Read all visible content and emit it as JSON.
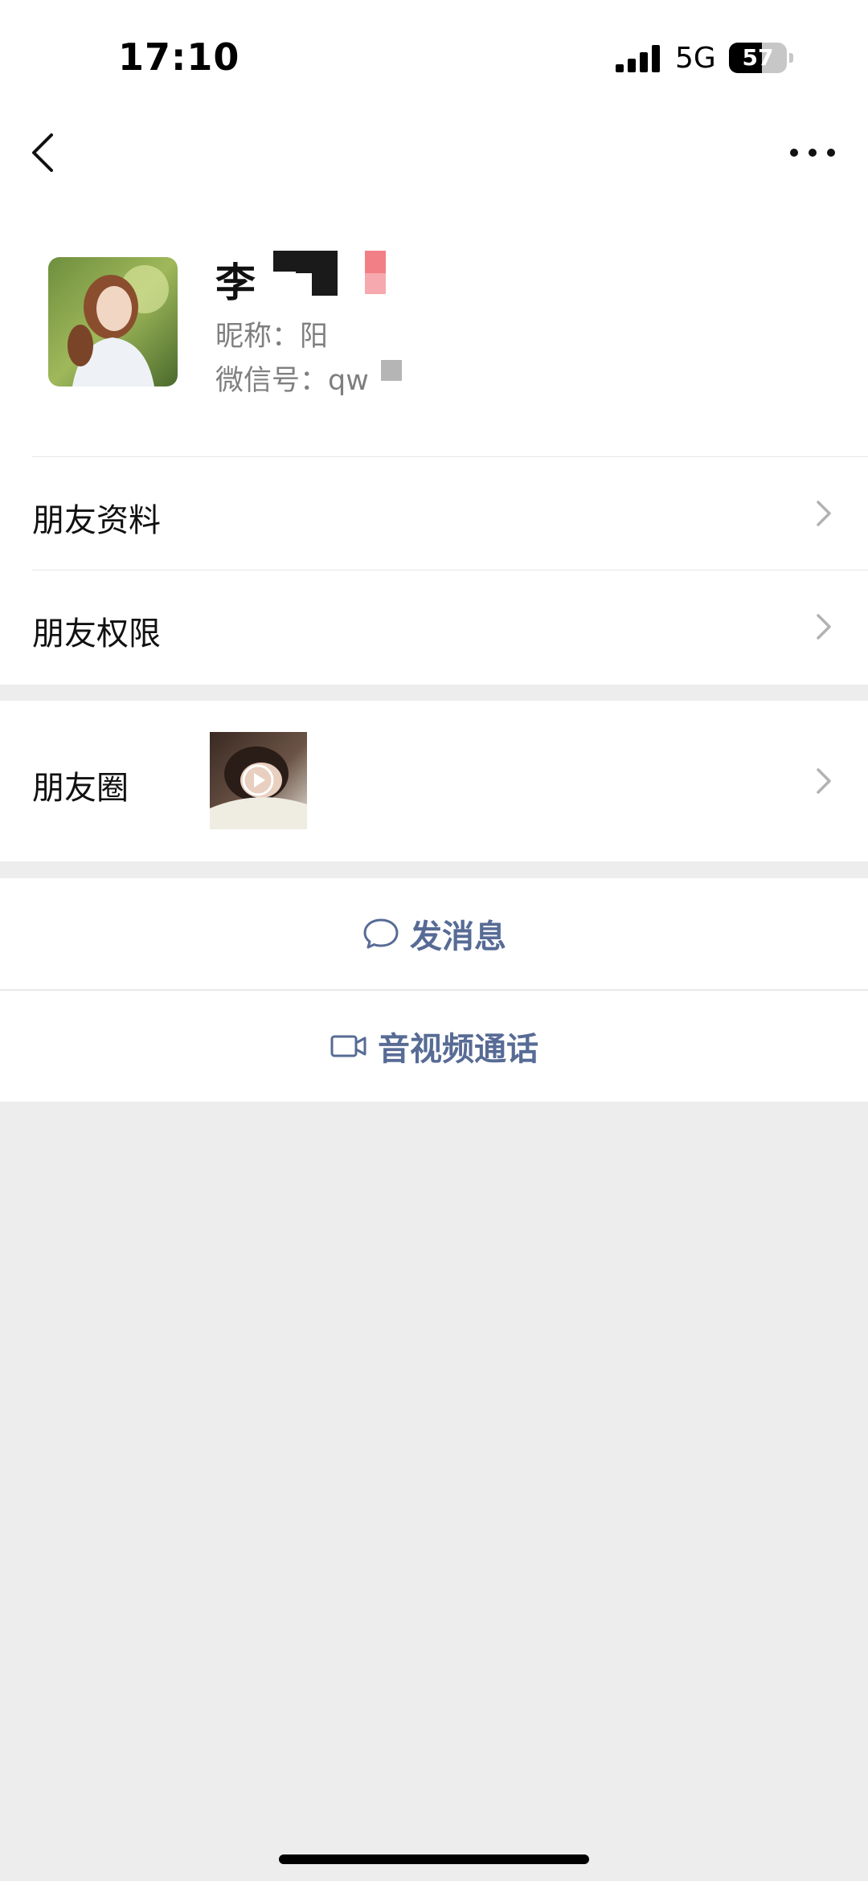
{
  "status_bar": {
    "time": "17:10",
    "network": "5G",
    "battery": "57",
    "battery_level": 0.57
  },
  "profile": {
    "name": "李",
    "nickname": "昵称：阳",
    "wechat_id": "微信号：qw"
  },
  "menu": {
    "friend_info": "朋友资料",
    "friend_permissions": "朋友权限",
    "moments": "朋友圈"
  },
  "actions": {
    "send_message": "发消息",
    "video_call": "音视频通话"
  },
  "icons": {
    "back": "chevron-left-icon",
    "more": "ellipsis-icon",
    "row_arrow": "chevron-right-icon",
    "message": "chat-bubble-icon",
    "video": "video-camera-icon",
    "play": "play-icon"
  },
  "colors": {
    "link_blue": "#576b95",
    "background": "#ededed",
    "secondary_text": "#7f7f7f"
  }
}
